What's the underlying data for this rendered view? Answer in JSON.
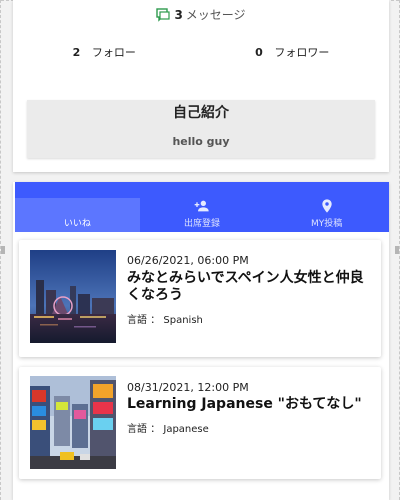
{
  "profile": {
    "messages": {
      "count": "3",
      "label": "メッセージ"
    },
    "follow": {
      "count": "2",
      "label": "フォロー"
    },
    "followers": {
      "count": "0",
      "label": "フォロワー"
    },
    "intro": {
      "title": "自己紹介",
      "text": "hello guy"
    }
  },
  "tabs": [
    {
      "label": "いいね",
      "icon": "heart-icon",
      "active": true
    },
    {
      "label": "出席登録",
      "icon": "add-person-icon",
      "active": false
    },
    {
      "label": "MY投稿",
      "icon": "location-pin-icon",
      "active": false
    }
  ],
  "posts": [
    {
      "date": "06/26/2021, 06:00 PM",
      "title": "みなとみらいでスペイン人女性と仲良くなろう",
      "language_label": "言語",
      "language": "Spanish",
      "image": "night-harbor-cityscape"
    },
    {
      "date": "08/31/2021, 12:00 PM",
      "title": "Learning Japanese \"おもてなし\"",
      "language_label": "言語",
      "language": "Japanese",
      "image": "times-square-billboards"
    }
  ],
  "colors": {
    "tab_bar": "#3d5afe",
    "tab_active": "#5c76ff",
    "message_icon": "#2e9b4e"
  }
}
